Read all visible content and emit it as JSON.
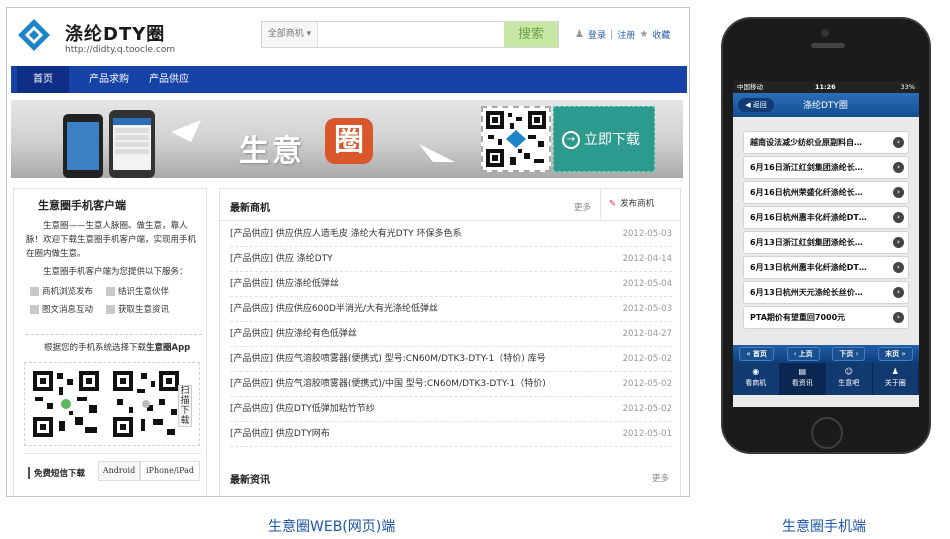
{
  "web": {
    "brand": "涤纶DTY圈",
    "url": "http://didty.q.toocle.com",
    "search": {
      "category": "全部商机",
      "placeholder": "",
      "button": "搜索"
    },
    "toplinks": {
      "login": "登录",
      "register": "注册",
      "favorite": "收藏"
    },
    "nav": [
      "首页",
      "产品求购",
      "产品供应"
    ],
    "banner": {
      "title": "生意",
      "badge": "圈",
      "download": "立即下载"
    },
    "client": {
      "heading": "生意圈手机客户端",
      "intro": "生意圈——生意人脉圈。做生意，靠人脉！欢迎下载生意圈手机客户端，实现用手机在圈内做生意。",
      "lead": "生意圈手机客户端为您提供以下服务：",
      "features": [
        "商机浏览发布",
        "结识生意伙伴",
        "图文消息互动",
        "获取生意资讯"
      ],
      "choose": "根据您的手机系统选择下载",
      "choose_bold": "生意圈App",
      "scan": "扫描下载",
      "sms": "免费短信下载",
      "tab_android": "Android",
      "tab_iphone": "iPhone/iPad"
    },
    "latest": {
      "heading": "最新商机",
      "more": "更多",
      "publish": "发布商机",
      "rows": [
        {
          "title": "[产品供应] 供应供应人造毛皮 涤纶大有光DTY 环保多色系",
          "date": "2012-05-03"
        },
        {
          "title": "[产品供应] 供应 涤纶DTY",
          "date": "2012-04-14"
        },
        {
          "title": "[产品供应] 供应涤纶低弹丝",
          "date": "2012-05-04"
        },
        {
          "title": "[产品供应] 供应供应600D半消光/大有光涤纶低弹丝",
          "date": "2012-05-03"
        },
        {
          "title": "[产品供应] 供应涤纶有色低弹丝",
          "date": "2012-04-27"
        },
        {
          "title": "[产品供应] 供应气溶胶喷雾器(便携式) 型号:CN60M/DTK3-DTY-1（特价) 库号",
          "date": "2012-05-02"
        },
        {
          "title": "[产品供应] 供应气溶胶喷雾器(便携式)/中国 型号:CN60M/DTK3-DTY-1（特价)",
          "date": "2012-05-02"
        },
        {
          "title": "[产品供应] 供应DTY低弹加粘竹节纱",
          "date": "2012-05-02"
        },
        {
          "title": "[产品供应] 供应DTY网布",
          "date": "2012-05-01"
        }
      ]
    },
    "news": {
      "heading": "最新资讯",
      "more": "更多"
    }
  },
  "mobile": {
    "status": {
      "carrier": "中国移动",
      "time": "11:26",
      "battery": "33%"
    },
    "back": "返回",
    "title": "涤纶DTY圈",
    "items": [
      "越南设法减少纺织业原副料自…",
      "6月16日浙江红剑集团涤纶长…",
      "6月16日杭州荣盛化纤涤纶长…",
      "6月16日杭州惠丰化纤涤纶DT…",
      "6月13日浙江红剑集团涤纶长…",
      "6月13日杭州惠丰化纤涤纶DT…",
      "6月13日杭州天元涤纶长丝价…",
      "PTA期价有望重回7000元"
    ],
    "pager": [
      "首页",
      "上页",
      "下页",
      "末页"
    ],
    "tabs": [
      "看商机",
      "看资讯",
      "生意吧",
      "关于圈"
    ],
    "active_tab": 1
  },
  "captions": {
    "web": "生意圈WEB(网页)端",
    "mobile": "生意圈手机端"
  }
}
